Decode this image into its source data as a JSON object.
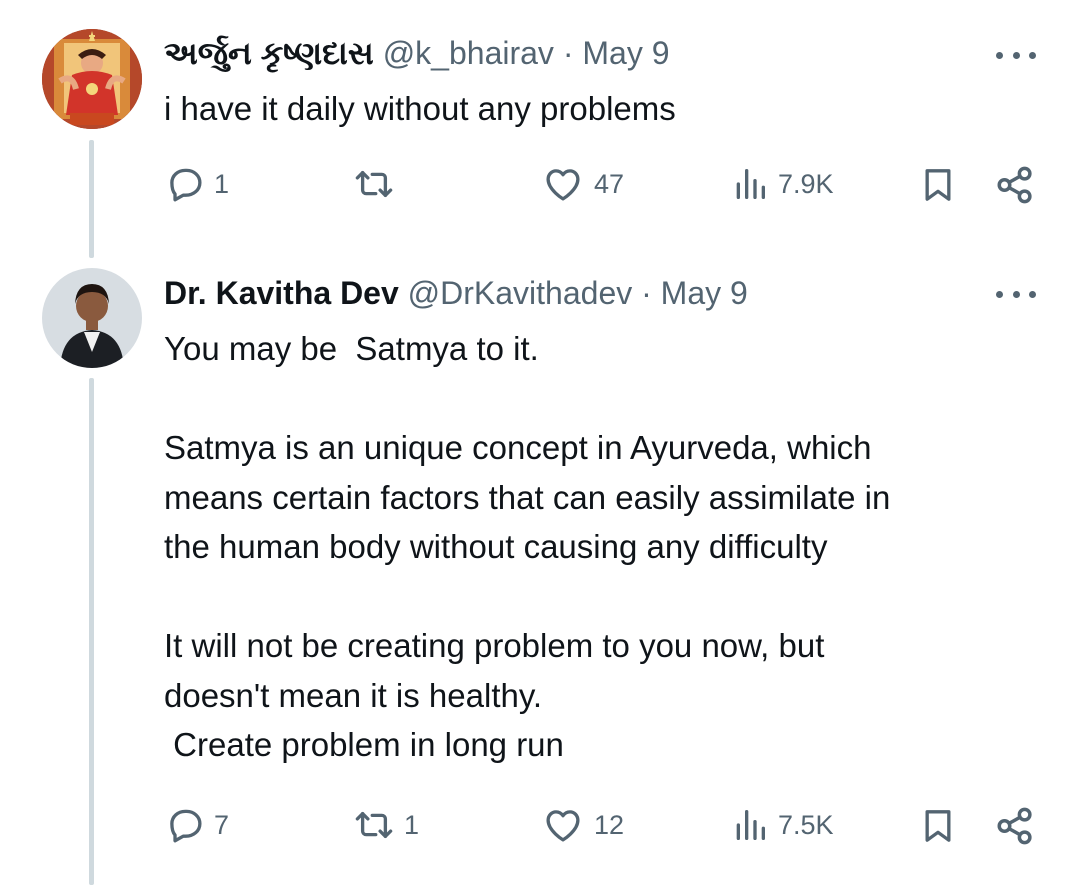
{
  "tweets": [
    {
      "name": "અર્જુન કૃષ્ણદાસ",
      "handle": "@k_bhairav",
      "separator": "·",
      "date": "May 9",
      "text": "i have it daily without any problems",
      "replies": "1",
      "retweets": "",
      "likes": "47",
      "views": "7.9K"
    },
    {
      "name": "Dr. Kavitha Dev",
      "handle": "@DrKavithadev",
      "separator": "·",
      "date": "May 9",
      "text": "You may be  Satmya to it.\n\nSatmya is an unique concept in Ayurveda, which\nmeans certain factors that can easily assimilate in\nthe human body without causing any difficulty\n\nIt will not be creating problem to you now, but\ndoesn't mean it is healthy.\n Create problem in long run",
      "replies": "7",
      "retweets": "1",
      "likes": "12",
      "views": "7.5K"
    }
  ],
  "icons": [
    "reply-icon",
    "retweet-icon",
    "like-icon",
    "views-icon",
    "bookmark-icon",
    "share-icon",
    "more-icon"
  ],
  "colors": {
    "muted": "#536471",
    "text": "#0f1419",
    "thread": "#cfd9de"
  }
}
